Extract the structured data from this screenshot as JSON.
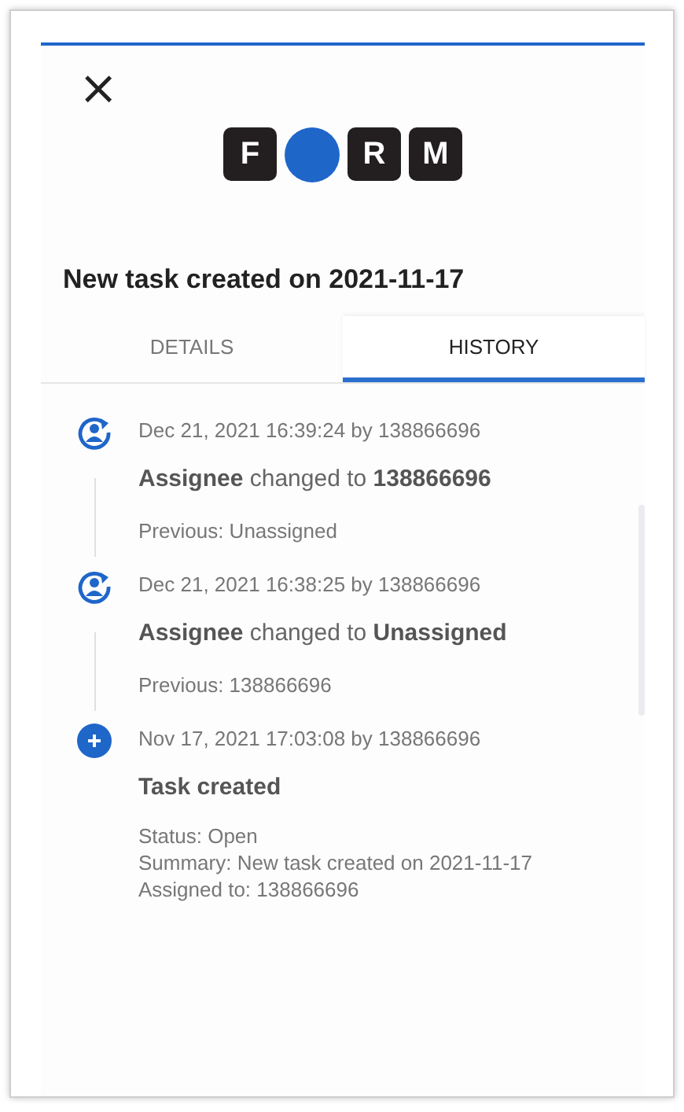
{
  "close": {
    "label": "×"
  },
  "logo": [
    {
      "kind": "tile",
      "text": "F"
    },
    {
      "kind": "dot"
    },
    {
      "kind": "tile",
      "text": "R"
    },
    {
      "kind": "tile",
      "text": "M"
    }
  ],
  "title": "New task created on 2021-11-17",
  "tabs": [
    {
      "label": "DETAILS",
      "selected": false
    },
    {
      "label": "HISTORY",
      "selected": true
    }
  ],
  "history": [
    {
      "kind": "reassign",
      "meta": "Dec 21, 2021 16:39:24 by 138866696",
      "headline": "**Assignee** changed to **138866696**",
      "details": [
        "Previous: Unassigned"
      ]
    },
    {
      "kind": "reassign",
      "meta": "Dec 21, 2021 16:38:25 by 138866696",
      "headline": "**Assignee** changed to **Unassigned**",
      "details": [
        "Previous: 138866696"
      ]
    },
    {
      "kind": "created",
      "meta": "Nov 17, 2021 17:03:08 by 138866696",
      "headline": "**Task created**",
      "details": [
        "Status: Open",
        "Summary: New task created on 2021-11-17",
        "Assigned to: 138866696"
      ]
    }
  ]
}
